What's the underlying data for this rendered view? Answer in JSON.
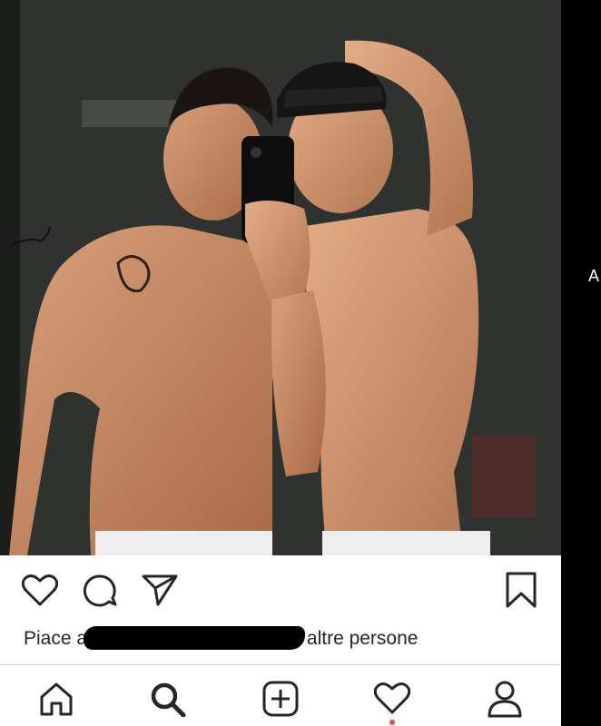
{
  "post": {
    "photo_alt": "",
    "likes_prefix": "Piace a",
    "likes_suffix": "altre persone"
  },
  "actions": {
    "like": "heart-icon",
    "comment": "comment-icon",
    "share": "direct-share-icon",
    "save": "bookmark-icon"
  },
  "tabbar": {
    "items": [
      "home-icon",
      "search-icon",
      "new-post-icon",
      "activity-icon",
      "profile-icon"
    ],
    "notification_color": "#ed4956"
  },
  "side_text": "A"
}
